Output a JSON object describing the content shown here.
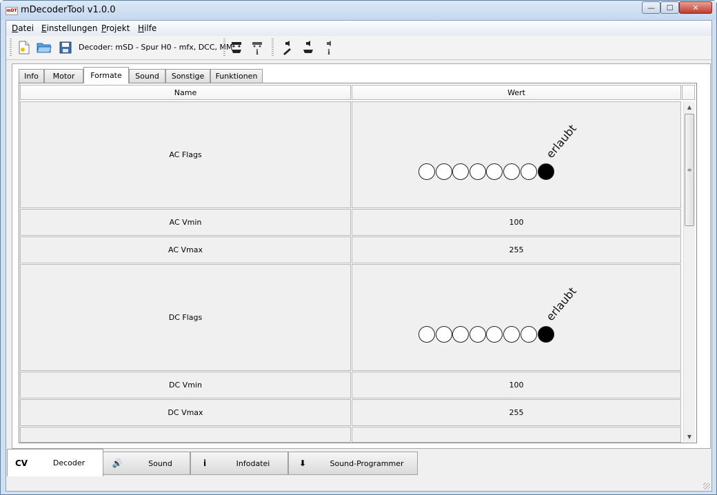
{
  "window": {
    "title": "mDecoderTool v1.0.0",
    "logo_text": "mDT",
    "minimize": "—",
    "maximize": "☐",
    "close": "✕"
  },
  "menu": [
    {
      "first": "D",
      "rest": "atei"
    },
    {
      "first": "E",
      "rest": "instellungen"
    },
    {
      "first": "P",
      "rest": "rojekt"
    },
    {
      "first": "H",
      "rest": "ilfe"
    }
  ],
  "toolbar": {
    "decoder_text": "Decoder: mSD - Spur H0 - mfx, DCC, MM",
    "icons": [
      "new-file-icon",
      "open-folder-icon",
      "save-icon",
      "loco-read-icon",
      "loco-info-icon",
      "sound-settings-icon",
      "sound-read-icon",
      "sound-info-icon"
    ]
  },
  "tabs": [
    "Info",
    "Motor",
    "Formate",
    "Sound",
    "Sonstige",
    "Funktionen"
  ],
  "active_tab": "Formate",
  "table": {
    "headers": {
      "name": "Name",
      "value": "Wert"
    },
    "rows": [
      {
        "name": "AC Flags",
        "type": "flags",
        "bits": [
          0,
          0,
          0,
          0,
          0,
          0,
          0,
          1
        ],
        "label": "erlaubt"
      },
      {
        "name": "AC Vmin",
        "type": "number",
        "value": "100"
      },
      {
        "name": "AC Vmax",
        "type": "number",
        "value": "255"
      },
      {
        "name": "DC Flags",
        "type": "flags",
        "bits": [
          0,
          0,
          0,
          0,
          0,
          0,
          0,
          1
        ],
        "label": "erlaubt"
      },
      {
        "name": "DC Vmin",
        "type": "number",
        "value": "100"
      },
      {
        "name": "DC Vmax",
        "type": "number",
        "value": "255"
      },
      {
        "name": "",
        "type": "number",
        "value": ""
      }
    ]
  },
  "bottom_tabs": [
    {
      "icon_text": "CV",
      "label": "Decoder",
      "active": true
    },
    {
      "icon_text": "🔊",
      "label": "Sound",
      "active": false
    },
    {
      "icon_text": "i",
      "label": "Infodatei",
      "active": false
    },
    {
      "icon_text": "⬇",
      "label": "Sound-Programmer",
      "active": false
    }
  ],
  "colors": {
    "bit_on": "#000000",
    "bit_off": "#ffffff",
    "cell_bg": "#f0f0f0"
  }
}
